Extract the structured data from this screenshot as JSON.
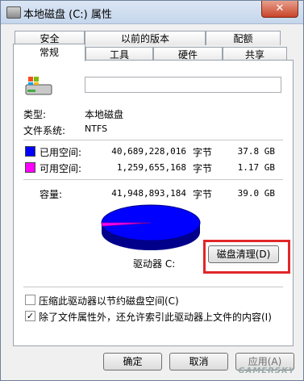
{
  "window": {
    "title": "本地磁盘 (C:) 属性",
    "close_label": "✕"
  },
  "tabs": {
    "row1": [
      "安全",
      "以前的版本",
      "配额"
    ],
    "row2": [
      "常规",
      "工具",
      "硬件",
      "共享"
    ]
  },
  "general": {
    "name_value": "",
    "type_label": "类型:",
    "type_value": "本地磁盘",
    "fs_label": "文件系统:",
    "fs_value": "NTFS",
    "used": {
      "label": "已用空间:",
      "bytes": "40,689,228,016",
      "unit": "字节",
      "size": "37.8 GB",
      "color": "#0000ff"
    },
    "free": {
      "label": "可用空间:",
      "bytes": "1,259,655,168",
      "unit": "字节",
      "size": "1.17 GB",
      "color": "#ff00ff"
    },
    "capacity": {
      "label": "容量:",
      "bytes": "41,948,893,184",
      "unit": "字节",
      "size": "39.0 GB"
    },
    "drive_label": "驱动器 C:",
    "cleanup_label": "磁盘清理(D)",
    "compress_label": "压缩此驱动器以节约磁盘空间(C)",
    "compress_checked": false,
    "index_label": "除了文件属性外，还允许索引此驱动器上文件的内容(I)",
    "index_checked": true
  },
  "buttons": {
    "ok": "确定",
    "cancel": "取消",
    "apply": "应用(A)"
  },
  "watermark": "GAMERSKY"
}
